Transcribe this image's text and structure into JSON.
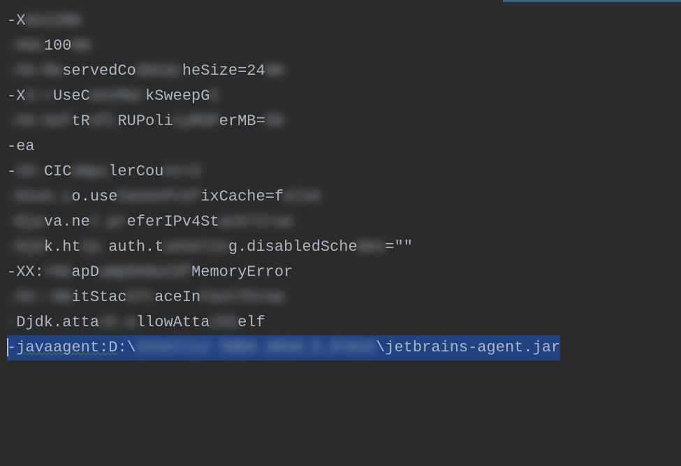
{
  "editor": {
    "lines": [
      {
        "segments": [
          {
            "text": "-X",
            "blur": false
          },
          {
            "text": "ms128m",
            "blur": true
          }
        ]
      },
      {
        "segments": [
          {
            "text": "-Xmx",
            "blur": true
          },
          {
            "text": "100",
            "blur": false
          },
          {
            "text": "0m",
            "blur": true
          }
        ]
      },
      {
        "segments": [
          {
            "text": "-XX:Re",
            "blur": true
          },
          {
            "text": "servedCo",
            "blur": false
          },
          {
            "text": "deCac",
            "blur": true
          },
          {
            "text": "heSize=24",
            "blur": false
          },
          {
            "text": "0m",
            "blur": true
          }
        ]
      },
      {
        "segments": [
          {
            "text": "-X",
            "blur": false
          },
          {
            "text": "X:+",
            "blur": true
          },
          {
            "text": "UseC",
            "blur": false
          },
          {
            "text": "oncMar",
            "blur": true
          },
          {
            "text": "kSweepG",
            "blur": false
          },
          {
            "text": "C",
            "blur": true
          }
        ]
      },
      {
        "segments": [
          {
            "text": "-XX:Sof",
            "blur": true
          },
          {
            "text": "tR",
            "blur": false
          },
          {
            "text": "efL",
            "blur": true
          },
          {
            "text": "RUPoli",
            "blur": false
          },
          {
            "text": "cyMSP",
            "blur": true
          },
          {
            "text": "erMB=",
            "blur": false
          },
          {
            "text": "50",
            "blur": true
          }
        ]
      },
      {
        "segments": [
          {
            "text": "-ea",
            "blur": false
          }
        ]
      },
      {
        "segments": [
          {
            "text": "-",
            "blur": false
          },
          {
            "text": "XX:",
            "blur": true
          },
          {
            "text": "CIC",
            "blur": false
          },
          {
            "text": "ompi",
            "blur": true
          },
          {
            "text": "lerCou",
            "blur": false
          },
          {
            "text": "nt=2",
            "blur": true
          }
        ]
      },
      {
        "segments": [
          {
            "text": "-Dsun.i",
            "blur": true
          },
          {
            "text": "o.use",
            "blur": false
          },
          {
            "text": "Canon",
            "blur": true
          },
          {
            "text": "Pref",
            "blur": true
          },
          {
            "text": "ixCache=f",
            "blur": false
          },
          {
            "text": "alse",
            "blur": true
          }
        ]
      },
      {
        "segments": [
          {
            "text": "-Dja",
            "blur": true
          },
          {
            "text": "va.ne",
            "blur": false
          },
          {
            "text": "t.pr",
            "blur": true
          },
          {
            "text": "ef",
            "blur": false
          },
          {
            "text": "erIPv4St",
            "blur": false
          },
          {
            "text": "ack=true",
            "blur": true
          }
        ]
      },
      {
        "segments": [
          {
            "text": "-Djd",
            "blur": true
          },
          {
            "text": "k.ht",
            "blur": false
          },
          {
            "text": "tp.",
            "blur": true
          },
          {
            "text": "auth.t",
            "blur": false
          },
          {
            "text": "unnelin",
            "blur": true
          },
          {
            "text": "g.disabledSche",
            "blur": false
          },
          {
            "text": "mes",
            "blur": true
          },
          {
            "text": "=\"\"",
            "blur": false
          }
        ]
      },
      {
        "segments": [
          {
            "text": "-XX:",
            "blur": false
          },
          {
            "text": "+He",
            "blur": true
          },
          {
            "text": "apD",
            "blur": false
          },
          {
            "text": "ump",
            "blur": true
          },
          {
            "text": "OnOut",
            "blur": true
          },
          {
            "text": "Of",
            "blur": true
          },
          {
            "text": "MemoryError",
            "blur": false
          }
        ]
      },
      {
        "segments": [
          {
            "text": "-XX:-Om",
            "blur": true
          },
          {
            "text": "itStac",
            "blur": false
          },
          {
            "text": "kTr",
            "blur": true
          },
          {
            "text": "aceIn",
            "blur": false
          },
          {
            "text": "FastThrow",
            "blur": true
          }
        ]
      },
      {
        "segments": [
          {
            "text": "-",
            "blur": true
          },
          {
            "text": "Djdk.atta",
            "blur": false
          },
          {
            "text": "ch.a",
            "blur": true
          },
          {
            "text": "llowAtta",
            "blur": false
          },
          {
            "text": "chS",
            "blur": true
          },
          {
            "text": "elf",
            "blur": false
          }
        ]
      },
      {
        "selected": true,
        "segments": [
          {
            "text": "-",
            "blur": false
          },
          {
            "text": "javaagent:D",
            "blur": false,
            "typo": true
          },
          {
            "text": ":\\",
            "blur": false
          },
          {
            "text": "IntelliJ IDEA 2019.3.3\\bin",
            "blur": true
          },
          {
            "text": "\\jetbrains-agent.jar",
            "blur": false
          }
        ]
      }
    ]
  }
}
